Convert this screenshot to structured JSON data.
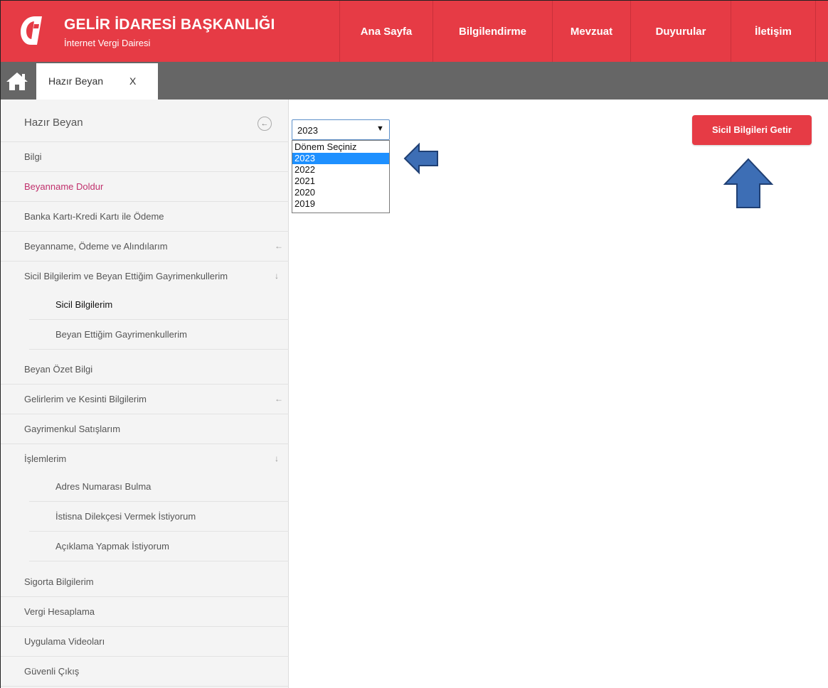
{
  "header": {
    "brand_title": "GELİR İDARESİ BAŞKANLIĞI",
    "brand_subtitle": "İnternet Vergi Dairesi",
    "nav": [
      "Ana Sayfa",
      "Bilgilendirme",
      "Mevzuat",
      "Duyurular",
      "İletişim"
    ],
    "brand_color": "#e63b45"
  },
  "tabs": {
    "active_label": "Hazır Beyan",
    "close_label": "X"
  },
  "sidebar": {
    "title": "Hazır Beyan",
    "collapse_icon": "←",
    "items": [
      {
        "label": "Bilgi"
      },
      {
        "label": "Beyanname Doldur"
      },
      {
        "label": "Banka Kartı-Kredi Kartı ile Ödeme"
      },
      {
        "label": "Beyanname, Ödeme ve Alındılarım",
        "arrow": "←"
      },
      {
        "label": "Sicil Bilgilerim ve Beyan Ettiğim Gayrimenkullerim",
        "arrow": "↓"
      },
      {
        "label": "Sicil Bilgilerim"
      },
      {
        "label": "Beyan Ettiğim Gayrimenkullerim"
      },
      {
        "label": "Beyan Özet Bilgi"
      },
      {
        "label": "Gelirlerim ve Kesinti Bilgilerim",
        "arrow": "←"
      },
      {
        "label": "Gayrimenkul Satışlarım"
      },
      {
        "label": "İşlemlerim",
        "arrow": "↓"
      },
      {
        "label": "Adres Numarası Bulma"
      },
      {
        "label": "İstisna Dilekçesi Vermek İstiyorum"
      },
      {
        "label": "Açıklama Yapmak İstiyorum"
      },
      {
        "label": "Sigorta Bilgilerim"
      },
      {
        "label": "Vergi Hesaplama"
      },
      {
        "label": "Uygulama Videoları"
      },
      {
        "label": "Güvenli Çıkış"
      }
    ]
  },
  "period_select": {
    "value": "2023",
    "caret": "▼",
    "options": [
      "Dönem Seçiniz",
      "2023",
      "2022",
      "2021",
      "2020",
      "2019"
    ],
    "selected_option": "2023"
  },
  "actions": {
    "get_registry_label": "Sicil Bilgileri Getir"
  },
  "annotation_color": "#3d6eb5"
}
